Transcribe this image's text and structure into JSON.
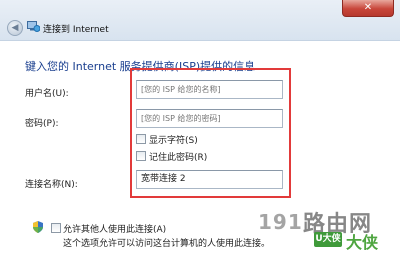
{
  "window": {
    "title": "连接到 Internet",
    "back_symbol": "◀",
    "close_symbol": "✕"
  },
  "heading": "键入您的 Internet 服务提供商(ISP)提供的信息",
  "form": {
    "username_label": "用户名(U):",
    "username_placeholder": "[您的 ISP 给您的名称]",
    "password_label": "密码(P):",
    "password_placeholder": "[您的 ISP 给您的密码]",
    "show_chars_label": "显示字符(S)",
    "remember_password_label": "记住此密码(R)",
    "connection_name_label": "连接名称(N):",
    "connection_name_value": "宽带连接 2"
  },
  "sharing": {
    "allow_others_label": "允许其他人使用此连接(A)",
    "note": "这个选项允许可以访问这台计算机的人使用此连接。"
  },
  "watermark": {
    "number": "191",
    "text": "路由网",
    "badge": "U大侠",
    "badge_suffix": "大侠"
  },
  "colors": {
    "heading": "#1a3f8f",
    "highlight_frame": "#e23a3a",
    "close_button": "#c8463a"
  }
}
